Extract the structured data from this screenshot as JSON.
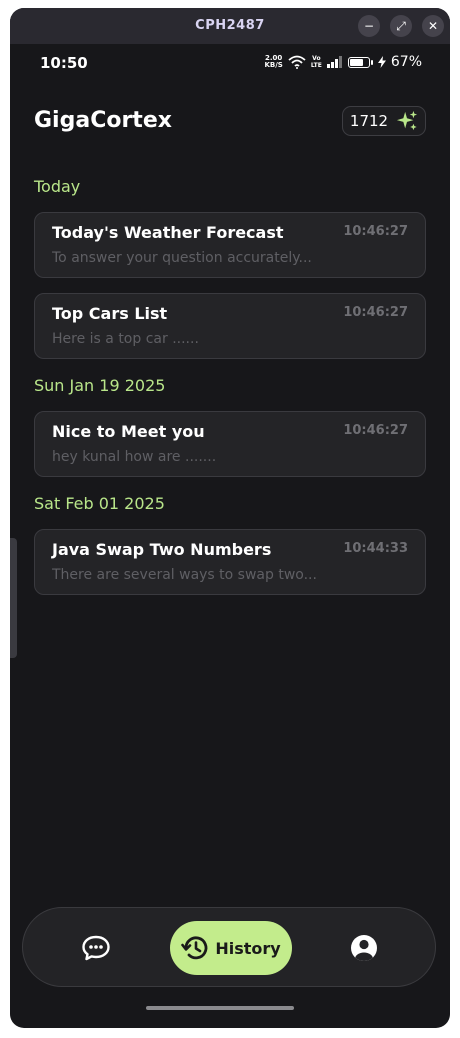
{
  "window": {
    "title": "CPH2487",
    "minimize": "−",
    "maximize": "⤢",
    "close": "✕"
  },
  "statusbar": {
    "time": "10:50",
    "net_speed": "2.00",
    "net_unit": "KB/S",
    "volte_top": "Vo",
    "volte_bottom": "LTE",
    "battery": "67%"
  },
  "header": {
    "title": "GigaCortex",
    "credits": "1712"
  },
  "sections": [
    {
      "label": "Today",
      "items": [
        {
          "title": "Today's Weather Forecast",
          "time": "10:46:27",
          "preview": "To  answer your question accurately..."
        },
        {
          "title": "Top Cars List",
          "time": "10:46:27",
          "preview": "Here is a top car ......"
        }
      ]
    },
    {
      "label": "Sun Jan 19 2025",
      "items": [
        {
          "title": "Nice to Meet you",
          "time": "10:46:27",
          "preview": "hey kunal how are ......."
        }
      ]
    },
    {
      "label": "Sat Feb 01 2025",
      "items": [
        {
          "title": "Java Swap Two Numbers",
          "time": "10:44:33",
          "preview": "There  are several ways to swap two..."
        }
      ]
    }
  ],
  "nav": {
    "history_label": "History",
    "active": "history",
    "accent": "#c3ec8c"
  },
  "icons": {
    "chat": "chat-bubble-icon",
    "history": "history-clock-icon",
    "profile": "profile-icon",
    "sparkle": "sparkle-icon"
  }
}
